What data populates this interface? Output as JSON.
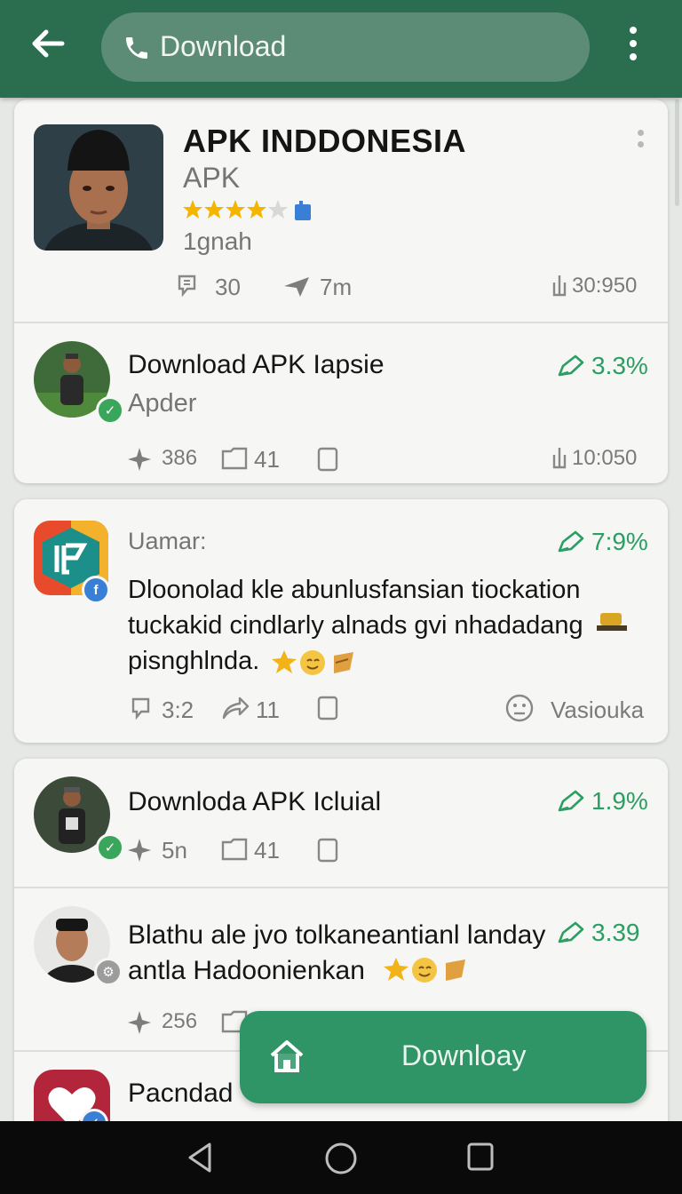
{
  "topbar": {
    "search_text": "Download"
  },
  "app_card": {
    "title": "APK INDDONESIA",
    "subtitle": "APK",
    "rating_stars": 4.5,
    "size_text": "1gnah",
    "stat_comments": "30",
    "stat_time": "7m",
    "stat_version": "30:950"
  },
  "item1": {
    "title": "Download APK Iapsie",
    "subtitle": "Apder",
    "percent": "3.3%",
    "stat_a": "386",
    "stat_b": "41",
    "stat_time": "10:050"
  },
  "item2": {
    "author": "Uamar:",
    "percent": "7:9%",
    "line1": "Dloonolad kle abunlusfansian tiockation",
    "line2": "tuckakid cindlarly alnads gvi nhadadang",
    "line3": "pisnghlnda.",
    "stat_a": "3:2",
    "stat_b": "11",
    "status": "Vasiouka"
  },
  "item3": {
    "title": "Downloda APK Icluial",
    "percent": "1.9%",
    "stat_a": "5n",
    "stat_b": "41"
  },
  "item4": {
    "line1": "Blathu ale jvo tolkaneantianl landay",
    "line2": "antla Hadoonienkan",
    "percent": "3.39",
    "stat_a": "256"
  },
  "item5": {
    "title": "Pacndad"
  },
  "fab": {
    "label": "Downloay"
  },
  "colors": {
    "topbar": "#2a6e4f",
    "accent_green": "#2b9e63",
    "fab": "#2f9466",
    "star": "#f5b400"
  }
}
